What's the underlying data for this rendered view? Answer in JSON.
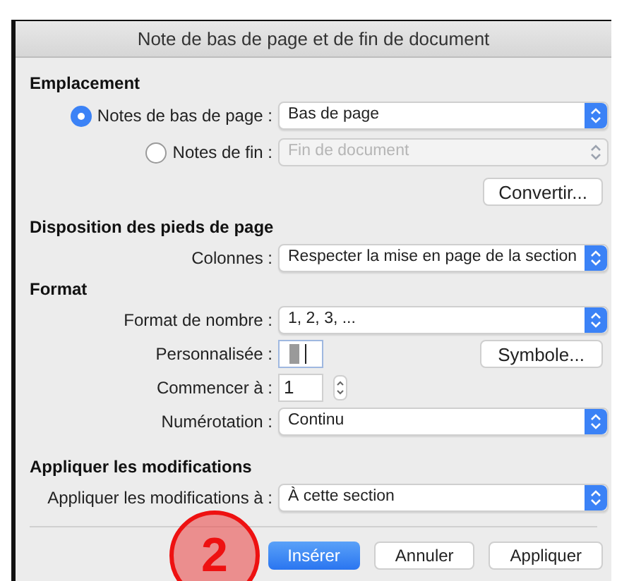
{
  "window": {
    "title": "Note de bas de page et de fin de document"
  },
  "sections": [
    {
      "heading": "Emplacement",
      "rows": [
        {
          "kind": "radio-select",
          "label": "Notes de bas de page :",
          "selected": true,
          "value": "Bas de page",
          "disabled": false
        },
        {
          "kind": "radio-select",
          "label": "Notes de fin :",
          "selected": false,
          "value": "Fin de document",
          "disabled": true
        },
        {
          "kind": "button",
          "label": "Convertir..."
        }
      ]
    },
    {
      "heading": "Disposition des pieds de page",
      "rows": [
        {
          "kind": "select",
          "label": "Colonnes :",
          "value": "Respecter la mise en page de la section",
          "disabled": false
        }
      ]
    },
    {
      "heading": "Format",
      "rows": [
        {
          "kind": "select",
          "label": "Format de nombre :",
          "value": "1, 2, 3, ...",
          "disabled": false
        },
        {
          "kind": "text-button",
          "label": "Personnalisée :",
          "button": "Symbole..."
        },
        {
          "kind": "stepper",
          "label": "Commencer à :",
          "value": "1"
        },
        {
          "kind": "select",
          "label": "Numérotation :",
          "value": "Continu",
          "disabled": false
        }
      ]
    },
    {
      "heading": "Appliquer les modifications",
      "rows": [
        {
          "kind": "select",
          "label": "Appliquer les modifications à :",
          "value": "À cette section",
          "disabled": false
        }
      ]
    }
  ],
  "buttons": [
    {
      "label": "Insérer",
      "default": true
    },
    {
      "label": "Annuler",
      "default": false
    },
    {
      "label": "Appliquer",
      "default": false
    }
  ],
  "annotation": {
    "text": "2"
  }
}
